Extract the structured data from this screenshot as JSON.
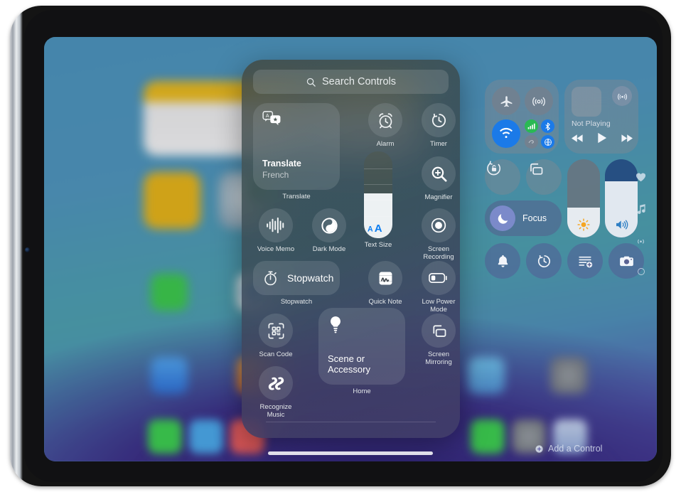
{
  "device": {
    "name": "ipad",
    "home_indicator": true
  },
  "control_center": {
    "gallery": {
      "search": {
        "placeholder": "Search Controls",
        "icon": "search-icon"
      },
      "controls": [
        {
          "id": "translate",
          "label": "Translate",
          "type": "large",
          "title": "Translate",
          "subtitle": "French",
          "icon": "translate-icon"
        },
        {
          "id": "alarm",
          "label": "Alarm",
          "type": "round",
          "icon": "alarm-clock-icon"
        },
        {
          "id": "timer",
          "label": "Timer",
          "type": "round",
          "icon": "timer-icon"
        },
        {
          "id": "magnifier",
          "label": "Magnifier",
          "type": "round",
          "icon": "magnifier-icon"
        },
        {
          "id": "voice-memo",
          "label": "Voice Memo",
          "type": "round",
          "icon": "waveform-icon"
        },
        {
          "id": "dark-mode",
          "label": "Dark Mode",
          "type": "round",
          "icon": "dark-mode-icon"
        },
        {
          "id": "text-size",
          "label": "Text Size",
          "type": "slider",
          "icon": "text-size-icon",
          "value_pct": 52,
          "glyph": "AA"
        },
        {
          "id": "screen-recording",
          "label": "Screen\nRecording",
          "type": "round",
          "icon": "record-icon"
        },
        {
          "id": "stopwatch",
          "label": "Stopwatch",
          "type": "wide",
          "title": "Stopwatch",
          "icon": "stopwatch-icon"
        },
        {
          "id": "quick-note",
          "label": "Quick Note",
          "type": "round",
          "icon": "quick-note-icon"
        },
        {
          "id": "low-power-mode",
          "label": "Low Power\nMode",
          "type": "round",
          "icon": "battery-low-icon"
        },
        {
          "id": "scan-code",
          "label": "Scan Code",
          "type": "round",
          "icon": "qr-scan-icon"
        },
        {
          "id": "scene-or-accessory",
          "label": "Home",
          "type": "large",
          "title": "Scene or Accessory",
          "icon": "lightbulb-icon"
        },
        {
          "id": "screen-mirroring",
          "label": "Screen\nMirroring",
          "type": "round",
          "icon": "screen-mirroring-icon"
        },
        {
          "id": "recognize-music",
          "label": "Recognize\nMusic",
          "type": "round",
          "icon": "shazam-icon"
        }
      ]
    },
    "panel": {
      "connectivity": {
        "airplane_mode": {
          "label": "Airplane Mode",
          "icon": "airplane-icon",
          "state": "off"
        },
        "airdrop": {
          "label": "AirDrop",
          "icon": "airdrop-icon",
          "state": "off"
        },
        "wifi": {
          "label": "Wi-Fi",
          "icon": "wifi-icon",
          "state": "on"
        },
        "cellular": {
          "label": "Cellular Data",
          "icon": "cellular-bars-icon",
          "state": "on"
        },
        "bluetooth": {
          "label": "Bluetooth",
          "icon": "bluetooth-icon",
          "state": "on"
        },
        "hotspot": {
          "label": "Personal Hotspot",
          "icon": "hotspot-icon",
          "state": "off"
        },
        "vpn": {
          "label": "VPN",
          "icon": "globe-icon",
          "state": "on"
        }
      },
      "media": {
        "status": "Not Playing",
        "airplay_icon": "airplay-icon",
        "artwork_icon": "album-art-placeholder",
        "previous_icon": "rewind-icon",
        "play_icon": "play-icon",
        "next_icon": "fast-forward-icon"
      },
      "rotation_lock": {
        "label": "Rotation Lock",
        "icon": "rotation-lock-icon",
        "state": "off"
      },
      "screen_mirroring": {
        "label": "Screen Mirroring",
        "icon": "screen-mirroring-icon",
        "state": "off"
      },
      "focus": {
        "label": "Focus",
        "icon": "moon-icon",
        "state": "off"
      },
      "brightness": {
        "label": "Brightness",
        "icon": "brightness-icon",
        "value_pct": 38,
        "color": "#f5a623"
      },
      "volume": {
        "label": "Volume",
        "icon": "speaker-wave-icon",
        "value_pct": 72,
        "color": "#2f7fc4"
      },
      "quick_actions": [
        {
          "id": "silent-mode",
          "label": "Silent Mode",
          "icon": "bell-icon"
        },
        {
          "id": "timer",
          "label": "Timer",
          "icon": "timer-icon"
        },
        {
          "id": "quick-note",
          "label": "Quick Note",
          "icon": "note-add-icon"
        },
        {
          "id": "camera",
          "label": "Camera",
          "icon": "camera-icon"
        }
      ]
    },
    "page_dots": [
      {
        "id": "favorites",
        "icon": "heart-icon"
      },
      {
        "id": "media",
        "icon": "music-note-icon"
      },
      {
        "id": "connectivity",
        "icon": "connectivity-icon"
      },
      {
        "id": "more",
        "icon": "circle-icon"
      }
    ],
    "add_control": {
      "label": "Add a Control",
      "icon": "plus-circle-icon"
    }
  }
}
